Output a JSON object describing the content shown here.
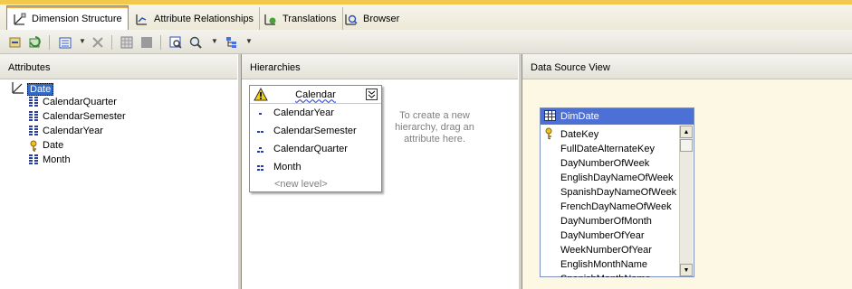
{
  "tabs": [
    {
      "label": "Dimension Structure",
      "icon": "dimension-structure-icon",
      "active": true
    },
    {
      "label": "Attribute Relationships",
      "icon": "attribute-relationships-icon",
      "active": false
    },
    {
      "label": "Translations",
      "icon": "translations-icon",
      "active": false
    },
    {
      "label": "Browser",
      "icon": "browser-icon",
      "active": false
    }
  ],
  "toolbar": {
    "icons": [
      "process-icon",
      "refresh-icon",
      "view-list-icon",
      "delete-icon",
      "grid-icon",
      "stop-icon",
      "find-table-icon",
      "zoom-icon",
      "arrange-icon"
    ]
  },
  "attributes": {
    "header": "Attributes",
    "root": "Date",
    "items": [
      "CalendarQuarter",
      "CalendarSemester",
      "CalendarYear",
      "Date",
      "Month"
    ]
  },
  "hierarchies": {
    "header": "Hierarchies",
    "hierarchy_name": "Calendar",
    "levels": [
      "CalendarYear",
      "CalendarSemester",
      "CalendarQuarter",
      "Month"
    ],
    "new_level": "<new level>",
    "hint": "To create a new hierarchy, drag an attribute here."
  },
  "dsv": {
    "header": "Data Source View",
    "table_name": "DimDate",
    "columns": [
      "DateKey",
      "FullDateAlternateKey",
      "DayNumberOfWeek",
      "EnglishDayNameOfWeek",
      "SpanishDayNameOfWeek",
      "FrenchDayNameOfWeek",
      "DayNumberOfMonth",
      "DayNumberOfYear",
      "WeekNumberOfYear",
      "EnglishMonthName",
      "SpanishMonthName"
    ]
  },
  "colors": {
    "selection": "#316ac5",
    "table_header": "#4c70d6",
    "dsv_background": "#fdf8e3",
    "tab_accent": "#f2c94c"
  }
}
